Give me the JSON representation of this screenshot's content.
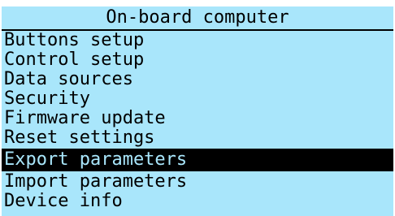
{
  "header": {
    "title": "On-board computer"
  },
  "menu": {
    "items": [
      {
        "label": "Buttons setup"
      },
      {
        "label": "Control setup"
      },
      {
        "label": "Data sources"
      },
      {
        "label": "Security"
      },
      {
        "label": "Firmware update"
      },
      {
        "label": "Reset settings"
      },
      {
        "label": "Export parameters",
        "selected": true
      },
      {
        "label": "Import parameters"
      },
      {
        "label": "Device info"
      }
    ]
  },
  "colors": {
    "background": "#a9e6fb",
    "text": "#000000",
    "selection_background": "#000000",
    "selection_text": "#a9e6fb"
  }
}
